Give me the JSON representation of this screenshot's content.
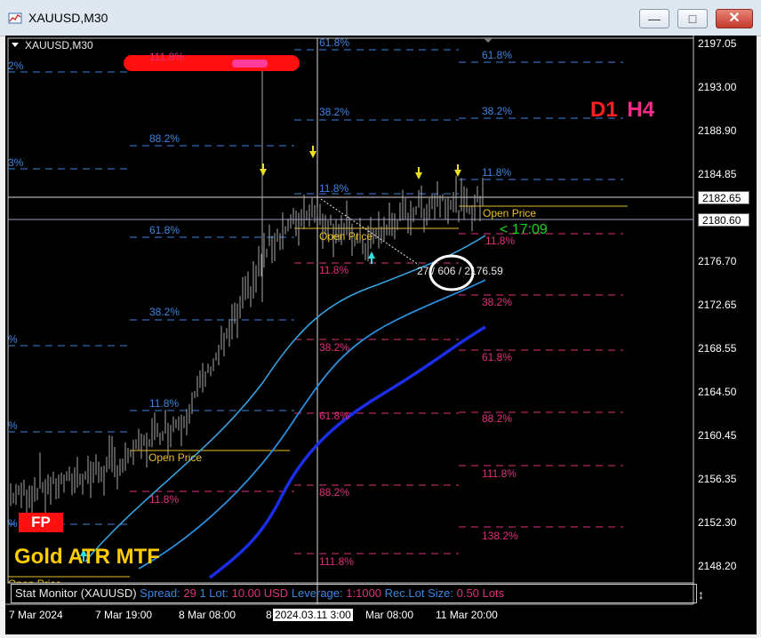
{
  "window": {
    "title": "XAUUSD,M30",
    "minimize": "—",
    "maximize": "□",
    "close": "✕"
  },
  "chart": {
    "symbol_label": "XAUUSD,M30",
    "tf_d1": "D1",
    "tf_h4": "H4",
    "timer": "< 17:09",
    "open_price": "Open Price",
    "fp_badge": "FP",
    "indicator_name": "Gold ATR MTF",
    "crosshair_readout": "27 / 606 / 2176.59",
    "fib_levels_left": [
      "2%",
      "3%",
      "%",
      "%",
      "%",
      "%"
    ],
    "fib_labels_a": [
      "111.8%",
      "88.2%",
      "61.8%",
      "38.2%",
      "11.8%",
      "11.8%"
    ],
    "fib_labels_b": [
      "61.8%",
      "38.2%",
      "11.8%",
      "11.8%",
      "38.2%",
      "61.8%",
      "88.2%",
      "111.8%"
    ],
    "fib_labels_c": [
      "61.8%",
      "38.2%",
      "11.8%",
      "11.8%",
      "38.2%",
      "61.8%",
      "88.2%",
      "111.8%",
      "138.2%"
    ]
  },
  "price_axis": {
    "ticks": [
      "2197.05",
      "2193.00",
      "2188.90",
      "2184.85",
      "2176.70",
      "2172.65",
      "2168.55",
      "2164.50",
      "2160.45",
      "2156.35",
      "2152.30",
      "2148.20"
    ],
    "current_price_box": "2182.65",
    "bid_price_box": "2180.60",
    "bottom_marker": "↕"
  },
  "time_axis": {
    "labels": [
      "7 Mar 2024",
      "7 Mar 19:00",
      "8 Mar 08:00",
      "8",
      "2024.03.11 3:00",
      "Mar 08:00",
      "11 Mar 20:00"
    ]
  },
  "stat_monitor": {
    "label": "Stat Monitor (XAUUSD)",
    "spread_label": "Spread:",
    "spread_value": "29",
    "lot_label": "1 Lot:",
    "lot_value": "10.00 USD",
    "leverage_label": "Leverage:",
    "leverage_value": "1:1000",
    "rec_label": "Rec.Lot Size:",
    "rec_value": "0.50 Lots"
  },
  "colors": {
    "background": "#000000",
    "fib_blue": "#3d84e0",
    "fib_magenta": "#e0307a",
    "open_price": "#e8c020",
    "ma_light": "#35a8e8",
    "ma_dark": "#1a2ee8",
    "timer": "#19d619",
    "d1": "#ff2020",
    "h4": "#ff2a8a"
  }
}
